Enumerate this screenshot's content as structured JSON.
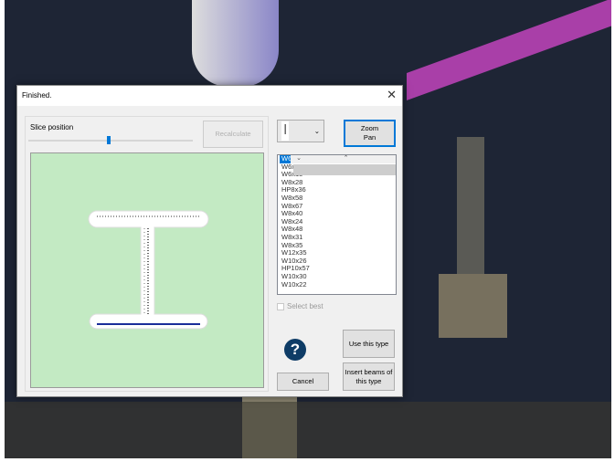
{
  "dialog": {
    "title": "Finished.",
    "close_icon": "close-icon"
  },
  "slice": {
    "label": "Slice position",
    "value_fraction": 0.5
  },
  "recalculate_label": "Recalculate",
  "zoom_pan": {
    "line1": "Zoom",
    "line2": "Pan"
  },
  "section_types": [
    "W6x25",
    "W6x20",
    "W6x15",
    "W8x28",
    "HP8x36",
    "W8x58",
    "W8x67",
    "W8x40",
    "W8x24",
    "W8x48",
    "W8x31",
    "W8x35",
    "W12x35",
    "W10x26",
    "HP10x57",
    "W10x30",
    "W10x22"
  ],
  "selected_type": "W6x25",
  "select_best_label": "Select best",
  "use_type_label": "Use this type",
  "insert_beams_label": "Insert beams of this type",
  "cancel_label": "Cancel",
  "help_glyph": "?",
  "colors": {
    "canvas": "#c3eac3",
    "selection": "#0078d7",
    "help": "#0e3c66"
  }
}
